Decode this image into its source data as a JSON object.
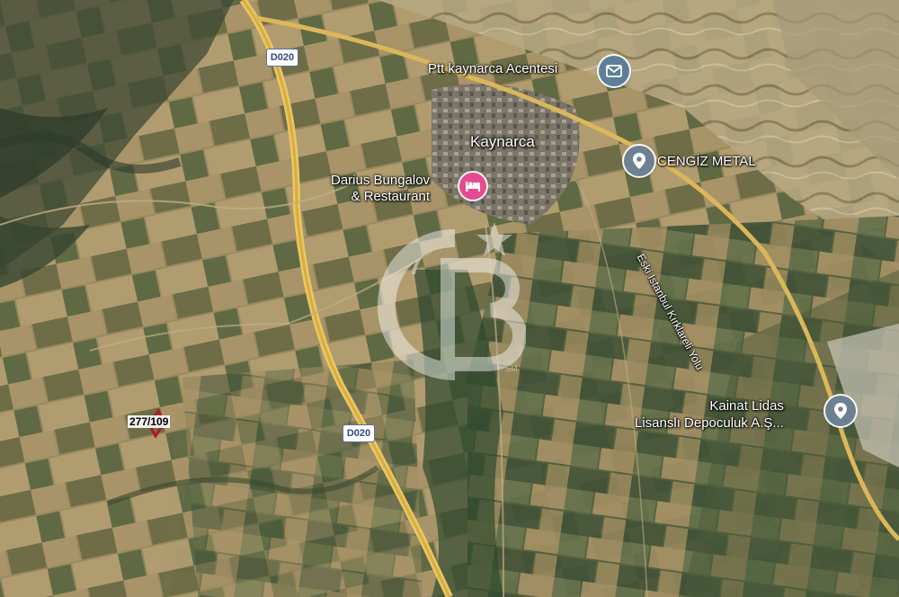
{
  "map": {
    "type": "satellite",
    "town": {
      "name": "Kaynarca"
    },
    "places": [
      {
        "id": "ptt",
        "name": "Ptt kaynarca Acentesi",
        "icon": "mail-icon",
        "color": "#5e7f97"
      },
      {
        "id": "darius",
        "name_line1": "Darius Bungalov",
        "name_line2": "& Restaurant",
        "icon": "hotel-bed-icon",
        "color": "#e64a91"
      },
      {
        "id": "cengiz",
        "name": "CENGİZ METAL",
        "icon": "location-pin-icon",
        "color": "#6e8193"
      },
      {
        "id": "kainat",
        "name_line1": "Kainat Lidas",
        "name_line2": "Lisanslı Depoculuk A.Ş...",
        "icon": "location-pin-icon",
        "color": "#6e8193"
      }
    ],
    "roads": [
      {
        "id": "d020-north",
        "label": "D020"
      },
      {
        "id": "d020-south",
        "label": "D020"
      },
      {
        "id": "eski-istanbul",
        "label": "Eski İstanbul Kırklareli Yolu"
      }
    ],
    "parcel": {
      "label": "277/109",
      "color": "#b0182a"
    },
    "watermark": {
      "brand": "CB",
      "mark": "SM"
    }
  }
}
